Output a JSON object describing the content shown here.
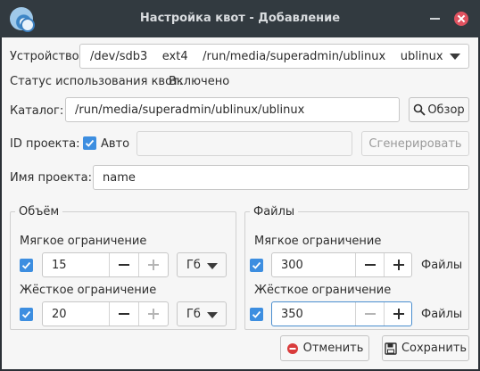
{
  "window": {
    "title": "Настройка квот - Добавление"
  },
  "device": {
    "label": "Устройство:",
    "value": "/dev/sdb3    ext4    /run/media/superadmin/ublinux    ublinux"
  },
  "status": {
    "label": "Статус использования квот:",
    "value": "Включено"
  },
  "catalog": {
    "label": "Каталог:",
    "value": "/run/media/superadmin/ublinux/ublinux",
    "browse_label": "Обзор"
  },
  "project_id": {
    "label": "ID проекта:",
    "auto_label": "Авто",
    "auto_checked": true,
    "value": "",
    "generate_label": "Сгенерировать"
  },
  "project_name": {
    "label": "Имя проекта:",
    "value": "name"
  },
  "volume": {
    "title": "Объём",
    "soft": {
      "label": "Мягкое ограничение",
      "enabled": true,
      "value": "15",
      "unit": "Гб"
    },
    "hard": {
      "label": "Жёсткое ограничение",
      "enabled": true,
      "value": "20",
      "unit": "Гб"
    }
  },
  "files": {
    "title": "Файлы",
    "soft": {
      "label": "Мягкое ограничение",
      "enabled": true,
      "value": "300",
      "unit": "Файлы"
    },
    "hard": {
      "label": "Жёсткое ограничение",
      "enabled": true,
      "value": "350",
      "unit": "Файлы"
    }
  },
  "footer": {
    "cancel_label": "Отменить",
    "save_label": "Сохранить"
  },
  "colors": {
    "accent": "#3d8ee0",
    "titlebar": "#323a40",
    "close": "#e05260"
  },
  "icons": [
    "app-icon",
    "minimize-icon",
    "close-icon",
    "search-icon",
    "cancel-icon",
    "save-icon",
    "check-icon"
  ]
}
